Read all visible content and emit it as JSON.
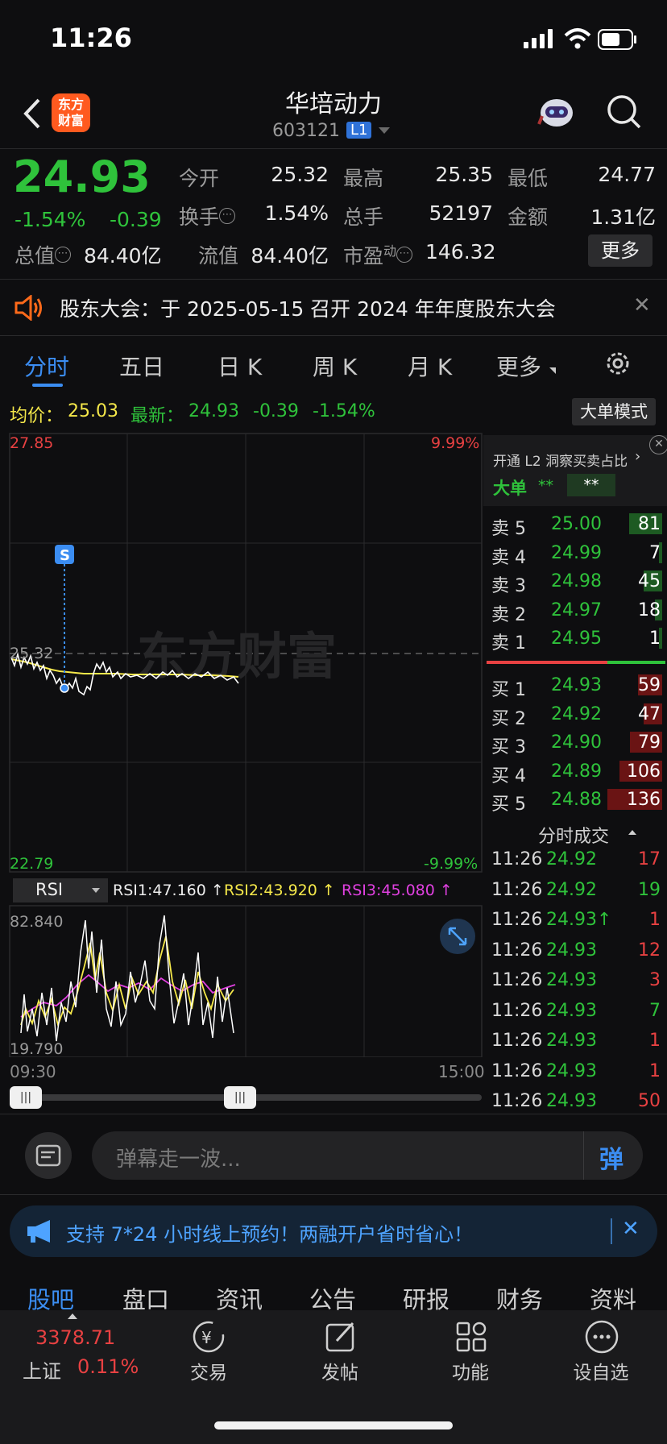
{
  "status_bar": {
    "time": "11:26"
  },
  "header": {
    "logo_text_1": "东方",
    "logo_text_2": "财富",
    "stock_name": "华培动力",
    "stock_code": "603121",
    "level_badge": "L1"
  },
  "quote": {
    "price": "24.93",
    "change_pct": "-1.54%",
    "change": "-0.39",
    "open_label": "今开",
    "open": "25.32",
    "high_label": "最高",
    "high": "25.35",
    "low_label": "最低",
    "low": "24.77",
    "turnover_label": "换手",
    "turnover": "1.54%",
    "volume_label": "总手",
    "volume": "52197",
    "amount_label": "金额",
    "amount": "1.31亿",
    "total_cap_label": "总值",
    "total_cap": "84.40亿",
    "float_cap_label": "流值",
    "float_cap": "84.40亿",
    "pe_label": "市盈",
    "pe_sup": "动",
    "pe": "146.32",
    "more_button": "更多"
  },
  "notice": {
    "text": "股东大会：于 2025-05-15 召开 2024 年年度股东大会"
  },
  "chart_tabs": [
    "分时",
    "五日",
    "日 K",
    "周 K",
    "月 K",
    "更多"
  ],
  "avg_line": {
    "avg_label": "均价：",
    "avg_value": "25.03",
    "latest_label": "最新：",
    "latest_value": "24.93",
    "latest_change": "-0.39",
    "latest_pct": "-1.54%",
    "big_order_button": "大单模式"
  },
  "intraday": {
    "top_price": "27.85",
    "top_pct": "9.99%",
    "ref_price": "25.32",
    "bottom_price": "22.79",
    "bottom_pct": "-9.99%",
    "watermark": "东方财富",
    "marker": "S",
    "start_time": "09:30",
    "end_time": "15:00"
  },
  "rsi": {
    "selector": "RSI",
    "rsi1": "RSI1:47.160 ↑",
    "rsi2": "RSI2:43.920 ↑",
    "rsi3": "RSI3:45.080 ↑",
    "max_label": "82.840",
    "min_label": "19.790"
  },
  "l2": {
    "banner": "开通 L2 洞察买卖占比",
    "big_order_label": "大单",
    "v1": "**",
    "v2": "**"
  },
  "order_book": {
    "sells": [
      {
        "label": "卖 5",
        "price": "25.00",
        "vol": "81"
      },
      {
        "label": "卖 4",
        "price": "24.99",
        "vol": "7"
      },
      {
        "label": "卖 3",
        "price": "24.98",
        "vol": "45"
      },
      {
        "label": "卖 2",
        "price": "24.97",
        "vol": "18"
      },
      {
        "label": "卖 1",
        "price": "24.95",
        "vol": "1"
      }
    ],
    "buys": [
      {
        "label": "买 1",
        "price": "24.93",
        "vol": "59"
      },
      {
        "label": "买 2",
        "price": "24.92",
        "vol": "47"
      },
      {
        "label": "买 3",
        "price": "24.90",
        "vol": "79"
      },
      {
        "label": "买 4",
        "price": "24.89",
        "vol": "106"
      },
      {
        "label": "买 5",
        "price": "24.88",
        "vol": "136"
      }
    ]
  },
  "trades": {
    "title": "分时成交",
    "rows": [
      {
        "time": "11:26",
        "price": "24.92",
        "vol": "17",
        "dir": "up"
      },
      {
        "time": "11:26",
        "price": "24.92",
        "vol": "19",
        "dir": "down"
      },
      {
        "time": "11:26",
        "price": "24.93↑",
        "vol": "1",
        "dir": "up"
      },
      {
        "time": "11:26",
        "price": "24.93",
        "vol": "12",
        "dir": "up"
      },
      {
        "time": "11:26",
        "price": "24.93",
        "vol": "3",
        "dir": "up"
      },
      {
        "time": "11:26",
        "price": "24.93",
        "vol": "7",
        "dir": "down"
      },
      {
        "time": "11:26",
        "price": "24.93",
        "vol": "1",
        "dir": "up"
      },
      {
        "time": "11:26",
        "price": "24.93",
        "vol": "1",
        "dir": "up"
      },
      {
        "time": "11:26",
        "price": "24.93",
        "vol": "50",
        "dir": "up"
      }
    ]
  },
  "danmaku": {
    "placeholder": "弹幕走一波...",
    "send": "弹"
  },
  "promo": {
    "text": "支持 7*24 小时线上预约！两融开户省时省心！"
  },
  "bottom_tabs": [
    "股吧",
    "盘口",
    "资讯",
    "公告",
    "研报",
    "财务",
    "资料"
  ],
  "bottom_nav": {
    "index_value": "3378.71",
    "index_name": "上证",
    "index_pct": "0.11%",
    "items": [
      "交易",
      "发帖",
      "功能",
      "设自选"
    ]
  },
  "colors": {
    "up": "#e84142",
    "down": "#2fc23b",
    "accent": "#3b8df2",
    "avg_line": "#f5e84a",
    "rsi3": "#e040e0"
  }
}
